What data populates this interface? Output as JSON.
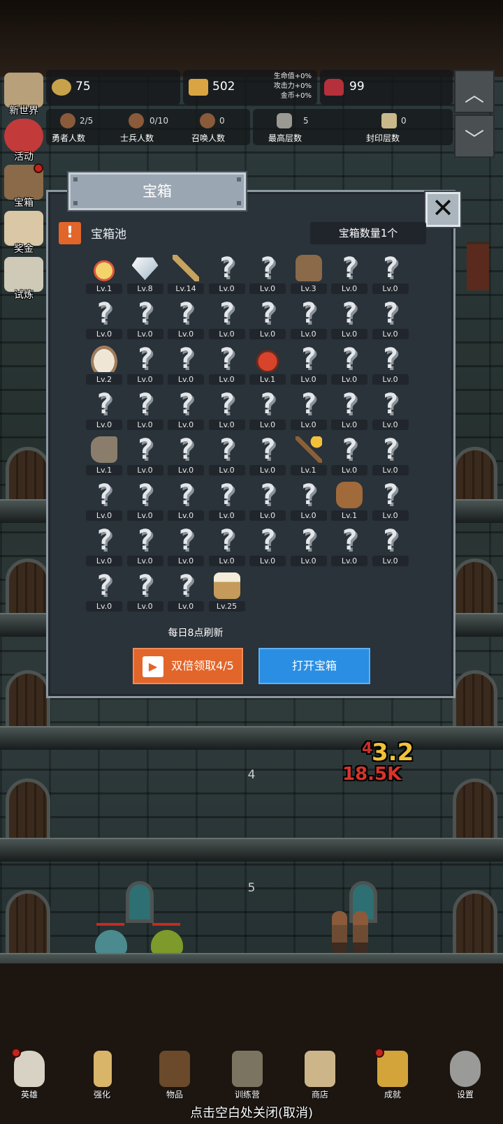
{
  "resources": {
    "coin": "75",
    "gold_bar": "502",
    "bonus_hp": "生命值+0%",
    "bonus_atk": "攻击力+0%",
    "bonus_gold": "金币+0%",
    "gem": "99"
  },
  "stats": [
    {
      "value": "2/5",
      "label": "勇者人数"
    },
    {
      "value": "0/10",
      "label": "士兵人数"
    },
    {
      "value": "0",
      "label": "召唤人数"
    },
    {
      "value": "5",
      "label": "最高层数"
    },
    {
      "value": "0",
      "label": "封印层数"
    }
  ],
  "scroll": {
    "up": "︿",
    "down": "﹀"
  },
  "left_nav": [
    {
      "label": "新世界"
    },
    {
      "label": "活动"
    },
    {
      "label": "宝箱"
    },
    {
      "label": "奖金"
    },
    {
      "label": "试炼"
    }
  ],
  "modal": {
    "title": "宝箱",
    "close": "✕",
    "warning": "!",
    "pool_label": "宝箱池",
    "count": "宝箱数量1个",
    "refresh": "每日8点刷新",
    "double_button": "双倍领取4/5",
    "open_button": "打开宝箱",
    "items": [
      {
        "icon": "crown-icon",
        "lv": "Lv.1"
      },
      {
        "icon": "diamond-icon",
        "lv": "Lv.8"
      },
      {
        "icon": "sword-icon",
        "lv": "Lv.14"
      },
      {
        "icon": "?",
        "lv": "Lv.0"
      },
      {
        "icon": "?",
        "lv": "Lv.0"
      },
      {
        "icon": "armor-icon",
        "lv": "Lv.3"
      },
      {
        "icon": "?",
        "lv": "Lv.0"
      },
      {
        "icon": "?",
        "lv": "Lv.0"
      },
      {
        "icon": "?",
        "lv": "Lv.0"
      },
      {
        "icon": "?",
        "lv": "Lv.0"
      },
      {
        "icon": "?",
        "lv": "Lv.0"
      },
      {
        "icon": "?",
        "lv": "Lv.0"
      },
      {
        "icon": "?",
        "lv": "Lv.0"
      },
      {
        "icon": "?",
        "lv": "Lv.0"
      },
      {
        "icon": "?",
        "lv": "Lv.0"
      },
      {
        "icon": "?",
        "lv": "Lv.0"
      },
      {
        "icon": "flour-bowl-icon",
        "lv": "Lv.2"
      },
      {
        "icon": "?",
        "lv": "Lv.0"
      },
      {
        "icon": "?",
        "lv": "Lv.0"
      },
      {
        "icon": "?",
        "lv": "Lv.0"
      },
      {
        "icon": "potion-icon",
        "lv": "Lv.1"
      },
      {
        "icon": "?",
        "lv": "Lv.0"
      },
      {
        "icon": "?",
        "lv": "Lv.0"
      },
      {
        "icon": "?",
        "lv": "Lv.0"
      },
      {
        "icon": "?",
        "lv": "Lv.0"
      },
      {
        "icon": "?",
        "lv": "Lv.0"
      },
      {
        "icon": "?",
        "lv": "Lv.0"
      },
      {
        "icon": "?",
        "lv": "Lv.0"
      },
      {
        "icon": "?",
        "lv": "Lv.0"
      },
      {
        "icon": "?",
        "lv": "Lv.0"
      },
      {
        "icon": "?",
        "lv": "Lv.0"
      },
      {
        "icon": "?",
        "lv": "Lv.0"
      },
      {
        "icon": "boot-icon",
        "lv": "Lv.1"
      },
      {
        "icon": "?",
        "lv": "Lv.0"
      },
      {
        "icon": "?",
        "lv": "Lv.0"
      },
      {
        "icon": "?",
        "lv": "Lv.0"
      },
      {
        "icon": "?",
        "lv": "Lv.0"
      },
      {
        "icon": "torch-icon",
        "lv": "Lv.1"
      },
      {
        "icon": "?",
        "lv": "Lv.0"
      },
      {
        "icon": "?",
        "lv": "Lv.0"
      },
      {
        "icon": "?",
        "lv": "Lv.0"
      },
      {
        "icon": "?",
        "lv": "Lv.0"
      },
      {
        "icon": "?",
        "lv": "Lv.0"
      },
      {
        "icon": "?",
        "lv": "Lv.0"
      },
      {
        "icon": "?",
        "lv": "Lv.0"
      },
      {
        "icon": "?",
        "lv": "Lv.0"
      },
      {
        "icon": "backpack-icon",
        "lv": "Lv.1"
      },
      {
        "icon": "?",
        "lv": "Lv.0"
      },
      {
        "icon": "?",
        "lv": "Lv.0"
      },
      {
        "icon": "?",
        "lv": "Lv.0"
      },
      {
        "icon": "?",
        "lv": "Lv.0"
      },
      {
        "icon": "?",
        "lv": "Lv.0"
      },
      {
        "icon": "?",
        "lv": "Lv.0"
      },
      {
        "icon": "?",
        "lv": "Lv.0"
      },
      {
        "icon": "?",
        "lv": "Lv.0"
      },
      {
        "icon": "?",
        "lv": "Lv.0"
      },
      {
        "icon": "?",
        "lv": "Lv.0"
      },
      {
        "icon": "?",
        "lv": "Lv.0"
      },
      {
        "icon": "?",
        "lv": "Lv.0"
      },
      {
        "icon": "beer-mug-icon",
        "lv": "Lv.25"
      }
    ]
  },
  "scene": {
    "floor_4": "4",
    "floor_5": "5",
    "damage_small": "4",
    "damage_big": "3.2",
    "damage_total": "18.5K"
  },
  "bottom_nav": [
    {
      "label": "英雄"
    },
    {
      "label": "强化"
    },
    {
      "label": "物品"
    },
    {
      "label": "训练营"
    },
    {
      "label": "商店"
    },
    {
      "label": "成就"
    },
    {
      "label": "设置"
    }
  ],
  "close_hint": "点击空白处关闭(取消)"
}
